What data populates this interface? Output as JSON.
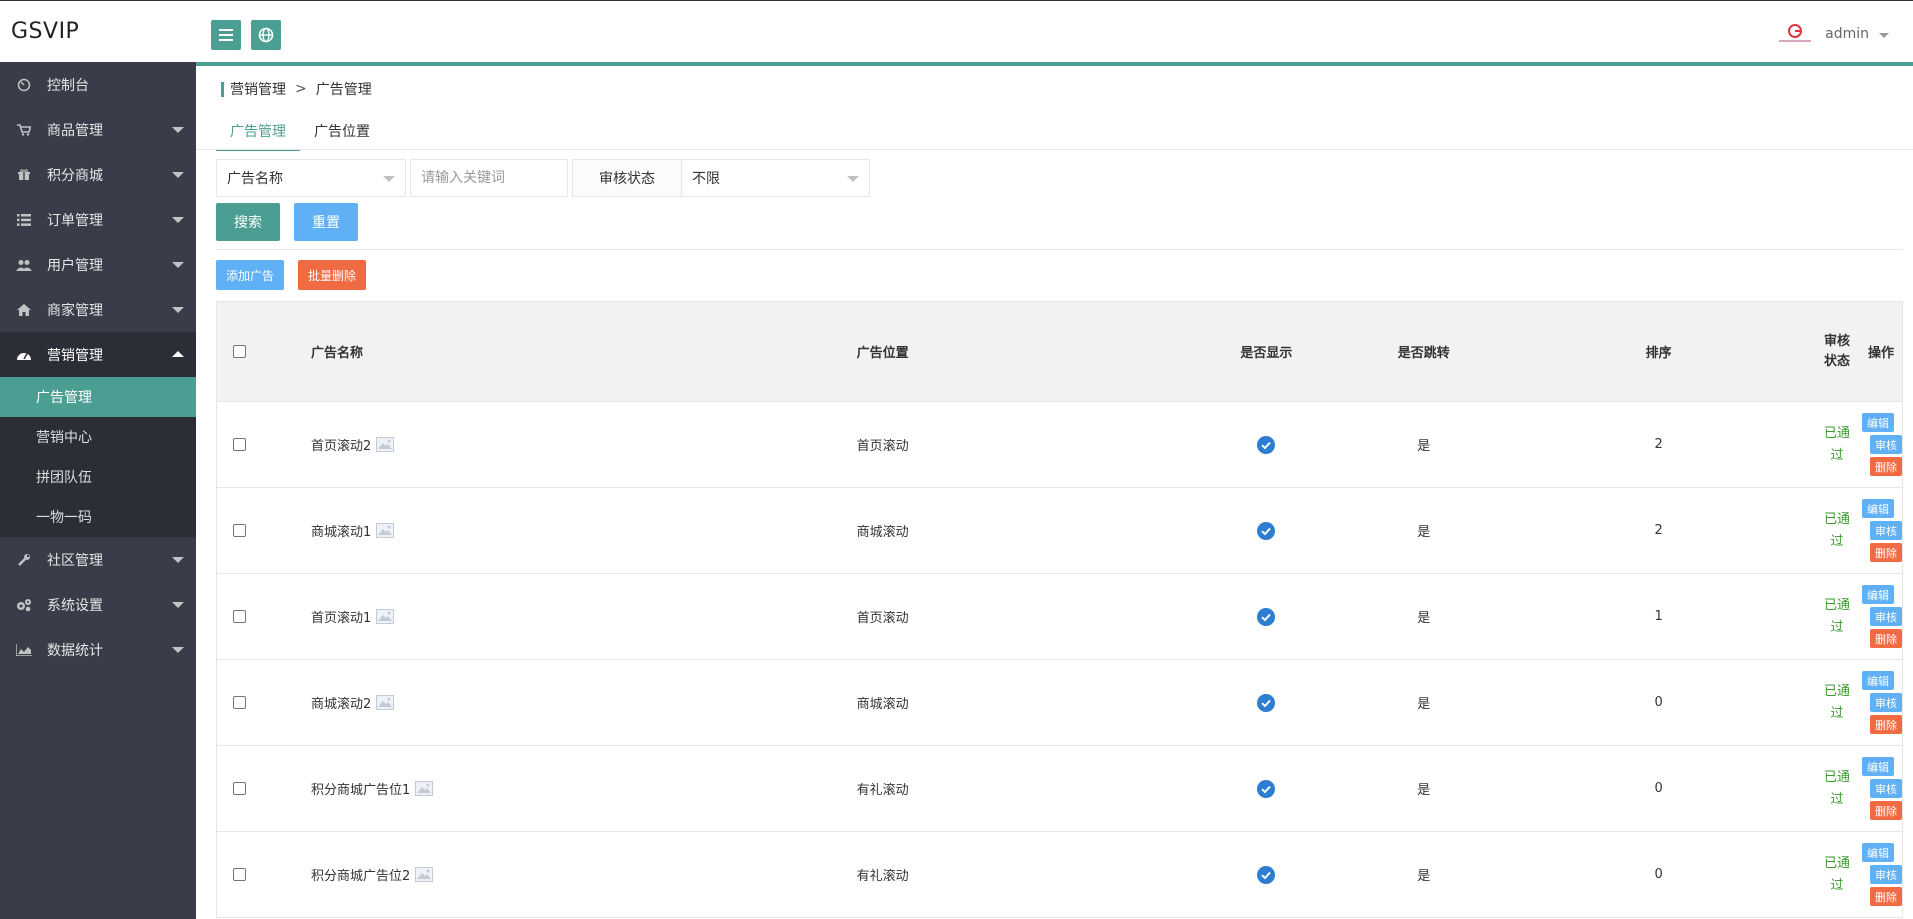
{
  "app": {
    "logo": "GSVIP"
  },
  "header": {
    "user_name": "admin"
  },
  "sidebar": {
    "items": [
      {
        "label": "控制台",
        "icon": "dashboard-icon",
        "has_arrow": false
      },
      {
        "label": "商品管理",
        "icon": "cart-icon",
        "has_arrow": true
      },
      {
        "label": "积分商城",
        "icon": "gift-icon",
        "has_arrow": true
      },
      {
        "label": "订单管理",
        "icon": "list-icon",
        "has_arrow": true
      },
      {
        "label": "用户管理",
        "icon": "users-icon",
        "has_arrow": true
      },
      {
        "label": "商家管理",
        "icon": "home-icon",
        "has_arrow": true
      },
      {
        "label": "营销管理",
        "icon": "gauge-icon",
        "has_arrow": true,
        "open": true
      },
      {
        "label": "社区管理",
        "icon": "wrench-icon",
        "has_arrow": true
      },
      {
        "label": "系统设置",
        "icon": "gears-icon",
        "has_arrow": true
      },
      {
        "label": "数据统计",
        "icon": "area-chart-icon",
        "has_arrow": true
      }
    ],
    "sub_items": [
      "广告管理",
      "营销中心",
      "拼团队伍",
      "一物一码"
    ]
  },
  "breadcrumb": {
    "parent": "营销管理",
    "sep": ">",
    "current": "广告管理"
  },
  "tabs": [
    "广告管理",
    "广告位置"
  ],
  "filter": {
    "field_select": "广告名称",
    "keyword_placeholder": "请输入关键词",
    "status_label": "审核状态",
    "status_value": "不限"
  },
  "buttons": {
    "search": "搜索",
    "reset": "重置",
    "add": "添加广告",
    "batch_delete": "批量删除"
  },
  "table": {
    "headers": {
      "name": "广告名称",
      "position": "广告位置",
      "show": "是否显示",
      "jump": "是否跳转",
      "sort": "排序",
      "status": "审核状态",
      "ops": "操作"
    },
    "rows": [
      {
        "name": "首页滚动2",
        "position": "首页滚动",
        "jump": "是",
        "sort": "2",
        "status": "已通过"
      },
      {
        "name": "商城滚动1",
        "position": "商城滚动",
        "jump": "是",
        "sort": "2",
        "status": "已通过"
      },
      {
        "name": "首页滚动1",
        "position": "首页滚动",
        "jump": "是",
        "sort": "1",
        "status": "已通过"
      },
      {
        "name": "商城滚动2",
        "position": "商城滚动",
        "jump": "是",
        "sort": "0",
        "status": "已通过"
      },
      {
        "name": "积分商城广告位1",
        "position": "有礼滚动",
        "jump": "是",
        "sort": "0",
        "status": "已通过"
      },
      {
        "name": "积分商城广告位2",
        "position": "有礼滚动",
        "jump": "是",
        "sort": "0",
        "status": "已通过"
      }
    ],
    "op_labels": {
      "edit": "编辑",
      "review": "审核",
      "delete": "删除"
    }
  },
  "colors": {
    "accent": "#4a9f92",
    "blue": "#5fb0f5",
    "danger": "#f06a42",
    "sidebar_bg": "#393d49",
    "status_green": "#3a9a2c"
  }
}
